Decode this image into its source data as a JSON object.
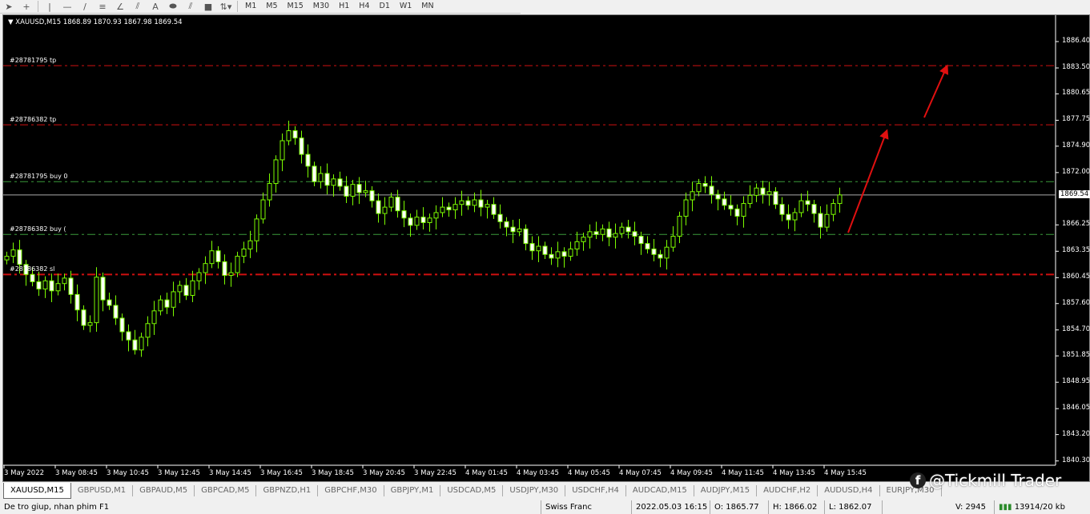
{
  "toolbar": {
    "tools": [
      {
        "icon": "cursor-icon",
        "g": "➤"
      },
      {
        "icon": "crosshair-icon",
        "g": "+"
      },
      {
        "icon": "vertical-line-icon",
        "g": "|"
      },
      {
        "icon": "horizontal-line-icon",
        "g": "—"
      },
      {
        "icon": "trendline-icon",
        "g": "/"
      },
      {
        "icon": "fibonacci-icon",
        "g": "≡"
      },
      {
        "icon": "angle-icon",
        "g": "∠"
      },
      {
        "icon": "fibo-expansion-icon",
        "g": "⫽"
      },
      {
        "icon": "text-icon",
        "g": "A"
      },
      {
        "icon": "ellipse-icon",
        "g": "⬬"
      },
      {
        "icon": "channel-icon",
        "g": "⫽"
      },
      {
        "icon": "rectangle-icon",
        "g": "■"
      },
      {
        "icon": "arrows-dropdown-icon",
        "g": "⇅▾"
      }
    ],
    "timeframes": [
      "M1",
      "M5",
      "M15",
      "M30",
      "H1",
      "H4",
      "D1",
      "W1",
      "MN"
    ]
  },
  "chart": {
    "header": "XAUUSD,M15  1868.89 1870.93 1867.98 1869.54",
    "current_price": "1869.54",
    "colors": {
      "background": "#000000",
      "candle": "#7cfc00",
      "tp_sl": "#d01010",
      "buy": "#3a9a3a",
      "arrow": "#e01010"
    },
    "order_lines": [
      {
        "label": "#28781795 tp",
        "price": 1883.75,
        "type": "tp"
      },
      {
        "label": "#28786382 tp",
        "price": 1877.25,
        "type": "tp"
      },
      {
        "label": "#28781795 buy 0",
        "price": 1871.0,
        "type": "buy"
      },
      {
        "label": "#28786382 buy (",
        "price": 1865.2,
        "type": "buy"
      },
      {
        "label": "#28786382 sl",
        "price": 1860.8,
        "type": "sl"
      }
    ],
    "y_ticks": [
      "1886.40",
      "1883.50",
      "1880.65",
      "1877.75",
      "1874.90",
      "1872.00",
      "1866.25",
      "1863.35",
      "1860.45",
      "1857.60",
      "1854.70",
      "1851.85",
      "1848.95",
      "1846.05",
      "1843.20",
      "1840.30"
    ],
    "x_ticks": [
      "3 May 2022",
      "3 May 08:45",
      "3 May 10:45",
      "3 May 12:45",
      "3 May 14:45",
      "3 May 16:45",
      "3 May 18:45",
      "3 May 20:45",
      "3 May 22:45",
      "4 May 01:45",
      "4 May 03:45",
      "4 May 05:45",
      "4 May 07:45",
      "4 May 09:45",
      "4 May 11:45",
      "4 May 13:45",
      "4 May 15:45"
    ],
    "closes": [
      1862.8,
      1863.5,
      1861.9,
      1860.8,
      1860.0,
      1859.2,
      1860.1,
      1859.0,
      1859.8,
      1860.4,
      1858.6,
      1856.9,
      1855.2,
      1855.5,
      1860.5,
      1858.0,
      1857.4,
      1856.0,
      1854.5,
      1853.6,
      1852.5,
      1853.9,
      1855.4,
      1856.8,
      1858.0,
      1857.2,
      1858.9,
      1859.6,
      1858.5,
      1860.1,
      1861.0,
      1862.0,
      1863.4,
      1862.2,
      1860.7,
      1861.0,
      1862.8,
      1863.6,
      1864.5,
      1866.9,
      1869.0,
      1870.8,
      1873.4,
      1875.5,
      1876.6,
      1875.8,
      1874.0,
      1872.7,
      1871.0,
      1871.9,
      1870.6,
      1871.3,
      1870.5,
      1869.4,
      1870.7,
      1869.8,
      1870.0,
      1868.9,
      1867.5,
      1868.2,
      1869.3,
      1867.8,
      1867.0,
      1866.2,
      1867.1,
      1866.5,
      1867.0,
      1867.6,
      1868.2,
      1867.9,
      1868.5,
      1868.9,
      1868.4,
      1869.0,
      1868.2,
      1868.5,
      1867.4,
      1866.6,
      1866.0,
      1865.5,
      1865.8,
      1864.2,
      1863.4,
      1863.9,
      1863.0,
      1862.6,
      1863.3,
      1862.8,
      1863.6,
      1864.4,
      1864.9,
      1865.5,
      1865.2,
      1865.8,
      1864.9,
      1865.3,
      1866.0,
      1865.5,
      1865.0,
      1864.2,
      1863.6,
      1863.0,
      1862.6,
      1863.8,
      1865.0,
      1867.2,
      1869.0,
      1869.9,
      1870.8,
      1870.5,
      1869.6,
      1869.1,
      1868.4,
      1868.0,
      1867.2,
      1868.6,
      1869.5,
      1870.3,
      1869.6,
      1869.9,
      1868.5,
      1867.4,
      1866.8,
      1867.6,
      1868.9,
      1868.5,
      1867.5,
      1866.0,
      1867.4,
      1868.6,
      1869.54
    ]
  },
  "tabs": [
    "XAUUSD,M15",
    "GBPUSD,M1",
    "GBPAUD,M5",
    "GBPCAD,M5",
    "GBPNZD,H1",
    "GBPCHF,M30",
    "GBPJPY,M1",
    "USDCAD,M5",
    "USDJPY,M30",
    "USDCHF,H4",
    "AUDCAD,M15",
    "AUDJPY,M15",
    "AUDCHF,H2",
    "AUDUSD,H4",
    "EURJPY,M30"
  ],
  "watermark": "@Tickmill Trader",
  "status": {
    "help": "De tro giup, nhan phim F1",
    "profile": "Swiss Franc",
    "datetime": "2022.05.03 16:15",
    "open": "O: 1865.77",
    "high": "H: 1866.02",
    "low": "L: 1862.07",
    "volume": "V: 2945",
    "traffic": "13914/20 kb"
  }
}
